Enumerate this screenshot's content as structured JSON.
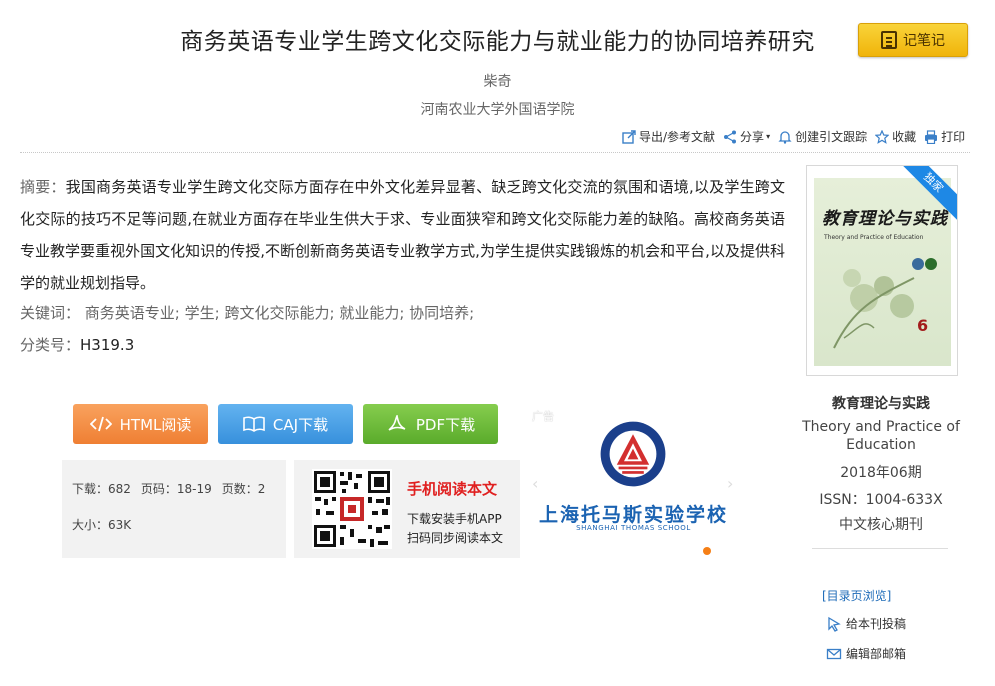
{
  "article": {
    "title": "商务英语专业学生跨文化交际能力与就业能力的协同培养研究",
    "author": "柴奇",
    "affiliation": "河南农业大学外国语学院"
  },
  "note_button": {
    "label": "记笔记"
  },
  "toolbar": {
    "export": "导出/参考文献",
    "share": "分享",
    "track": "创建引文跟踪",
    "favorite": "收藏",
    "print": "打印"
  },
  "abstract": {
    "label": "摘要：",
    "text": "我国商务英语专业学生跨文化交际方面存在中外文化差异显著、缺乏跨文化交流的氛围和语境,以及学生跨文化交际的技巧不足等问题,在就业方面存在毕业生供大于求、专业面狭窄和跨文化交际能力差的缺陷。高校商务英语专业教学要重视外国文化知识的传授,不断创新商务英语专业教学方式,为学生提供实践锻炼的机会和平台,以及提供科学的就业规划指导。"
  },
  "keywords": {
    "label": "关键词：",
    "items": [
      "商务英语专业;",
      "学生;",
      "跨文化交际能力;",
      "就业能力;",
      "协同培养;"
    ]
  },
  "classification": {
    "label": "分类号：",
    "value": "H319.3"
  },
  "downloads": {
    "html": "HTML阅读",
    "caj": "CAJ下载",
    "pdf": "PDF下载"
  },
  "stats": {
    "downloads": "下载：682",
    "pages_range": "页码：18-19",
    "page_count": "页数：2",
    "size": "大小：63K"
  },
  "mobile": {
    "title": "手机阅读本文",
    "line1": "下载安装手机APP",
    "line2": "扫码同步阅读本文"
  },
  "ad": {
    "label": "广告",
    "school_cn": "上海托马斯实验学校",
    "school_en": "SHANGHAI THOMAS SCHOOL"
  },
  "cover": {
    "badge": "独家",
    "title_cn": "教育理论与实践",
    "title_en": "Theory and Practice of Education",
    "issue": "6"
  },
  "journal": {
    "name": "教育理论与实践",
    "name_en": "Theory and Practice of Education",
    "date": "2018年06期",
    "issn": "ISSN：1004-633X",
    "core": "中文核心期刊"
  },
  "links": {
    "catalog": "[目录页浏览]",
    "submit": "给本刊投稿",
    "mail": "编辑部邮箱"
  },
  "colors": {
    "note_button": "#f0b40a",
    "html_button": "#ef7f33",
    "caj_button": "#3790dc",
    "pdf_button": "#5aab2b",
    "mobile_title": "#e02020",
    "link": "#1e6bb8"
  }
}
